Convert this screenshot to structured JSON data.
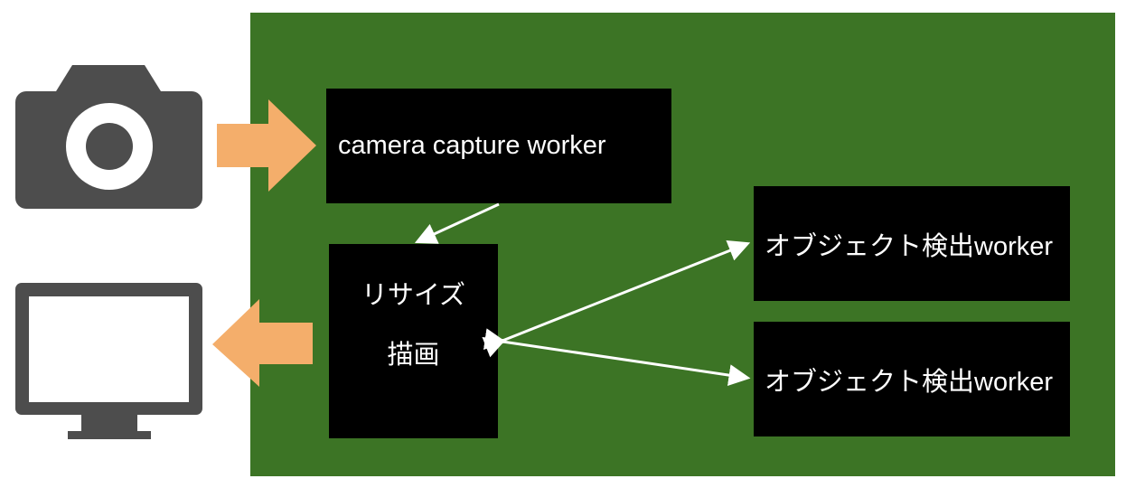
{
  "colors": {
    "panel": "#3c7425",
    "box": "#000000",
    "text": "#ffffff",
    "flow_arrow": "#f4ae6b",
    "device_icon": "#4d4d4d",
    "connector": "#ffffff"
  },
  "icons": {
    "input_device": "camera-icon",
    "output_device": "monitor-icon"
  },
  "nodes": {
    "capture": "camera capture worker",
    "resize": {
      "line1": "リサイズ",
      "line2": "描画"
    },
    "detector_1": "オブジェクト検出worker",
    "detector_2": "オブジェクト検出worker"
  }
}
